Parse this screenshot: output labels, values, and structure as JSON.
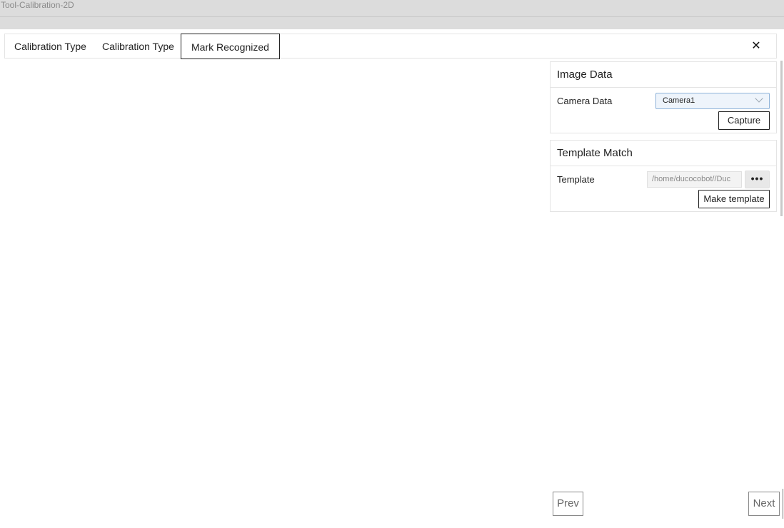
{
  "window": {
    "title": "Tool-Calibration-2D"
  },
  "tabs": [
    {
      "label": "Calibration Type"
    },
    {
      "label": "Calibration Type"
    },
    {
      "label": "Mark Recognized"
    }
  ],
  "close_label": "✕",
  "image_data": {
    "title": "Image Data",
    "camera_label": "Camera Data",
    "camera_value": "Camera1",
    "capture_label": "Capture"
  },
  "template_match": {
    "title": "Template Match",
    "template_label": "Template",
    "template_value": "/home/ducocobot//Duc",
    "browse_label": "•••",
    "make_label": "Make template"
  },
  "nav": {
    "prev_label": "Prev",
    "next_label": "Next"
  }
}
